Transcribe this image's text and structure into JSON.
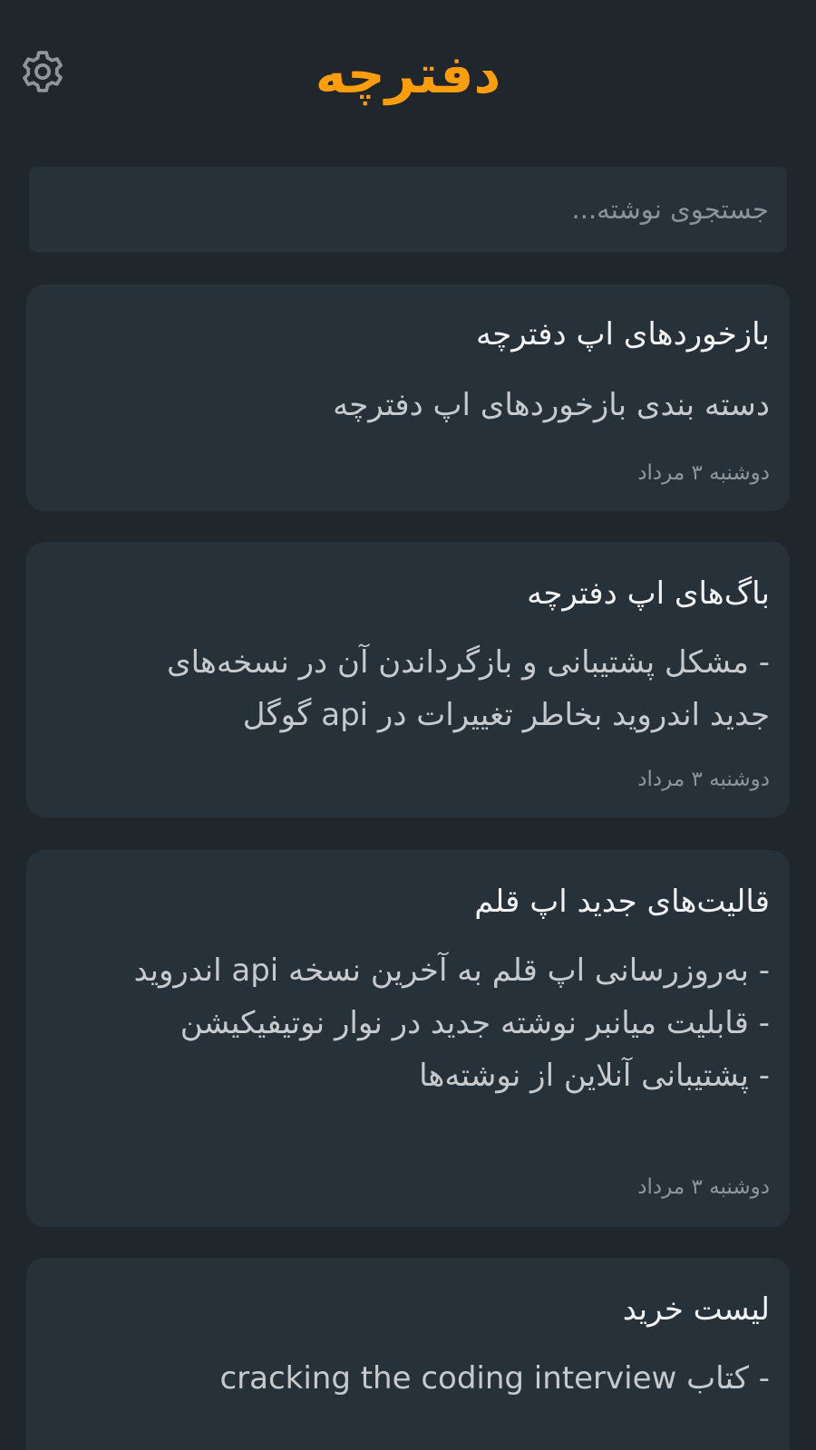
{
  "header": {
    "title": "دفترچه",
    "settings_icon": "gear-icon"
  },
  "search": {
    "placeholder": "جستجوی نوشته...",
    "value": ""
  },
  "notes": [
    {
      "title": "بازخوردهای اپ دفترچه",
      "lines": [
        "دسته بندی بازخوردهای اپ دفترچه"
      ],
      "date": "دوشنبه ۳ مرداد"
    },
    {
      "title": "باگ‌های اپ دفترچه",
      "lines": [
        "- مشکل پشتیبانی و بازگرداندن آن در نسخه‌های",
        "جدید اندروید بخاطر تغییرات در api گوگل"
      ],
      "date": "دوشنبه ۳ مرداد"
    },
    {
      "title": "قالیت‌های جدید اپ قلم",
      "lines": [
        "- به‌روزرسانی اپ قلم به آخرین نسخه api اندروید",
        "- قابلیت میانبر نوشته جدید در نوار نوتیفیکیشن",
        "- پشتیبانی آنلاین از نوشته‌ها"
      ],
      "date": "دوشنبه ۳ مرداد"
    },
    {
      "title": "لیست خرید",
      "lines": [
        "- کتاب cracking the coding interview"
      ],
      "date": ""
    }
  ],
  "colors": {
    "background": "#1f262c",
    "card": "#27313a",
    "accent": "#ff9d0a",
    "title_text": "#f2f2f2",
    "body_text": "#c6cacd",
    "meta_text": "#8f969b"
  }
}
